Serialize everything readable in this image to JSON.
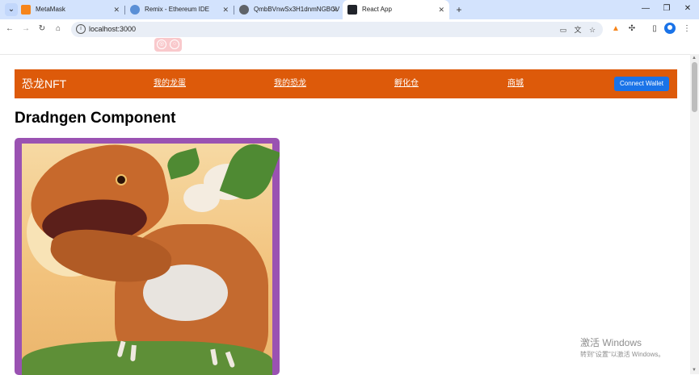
{
  "browser": {
    "tabs": [
      {
        "title": "MetaMask",
        "favicon_color": "#f6851b",
        "active": false
      },
      {
        "title": "Remix - Ethereum IDE",
        "favicon_color": "#5a8fd6",
        "active": false
      },
      {
        "title": "QmbBVnwSx3H1dnmNGBCV",
        "favicon_color": "#5f6368",
        "active": false
      },
      {
        "title": "React App",
        "favicon_color": "#20232a",
        "active": true
      }
    ],
    "url": "localhost:3000",
    "icons": {
      "tab_search": "chevron-down-icon",
      "tab_close": "close-icon",
      "new_tab": "plus-icon",
      "back": "arrow-left-icon",
      "forward": "arrow-right-icon",
      "reload": "reload-icon",
      "home": "home-icon",
      "site_info": "info-icon",
      "install": "install-app-icon",
      "translate": "translate-icon",
      "bookmark": "star-icon",
      "metamask": "fox-icon",
      "extensions": "puzzle-icon",
      "side_panel": "side-panel-icon",
      "profile": "profile-icon",
      "menu": "kebab-menu-icon"
    }
  },
  "app": {
    "brand": "恐龙NFT",
    "nav_links": [
      "我的龙蛋",
      "我的恐龙",
      "孵化仓",
      "商城"
    ],
    "connect_button": "Connect Wallet",
    "heading": "Dradngen Component",
    "accent_color": "#dd5a0a",
    "button_color": "#1a73e8"
  },
  "os": {
    "watermark_title": "激活 Windows",
    "watermark_subtitle": "转到\"设置\"以激活 Windows。"
  }
}
